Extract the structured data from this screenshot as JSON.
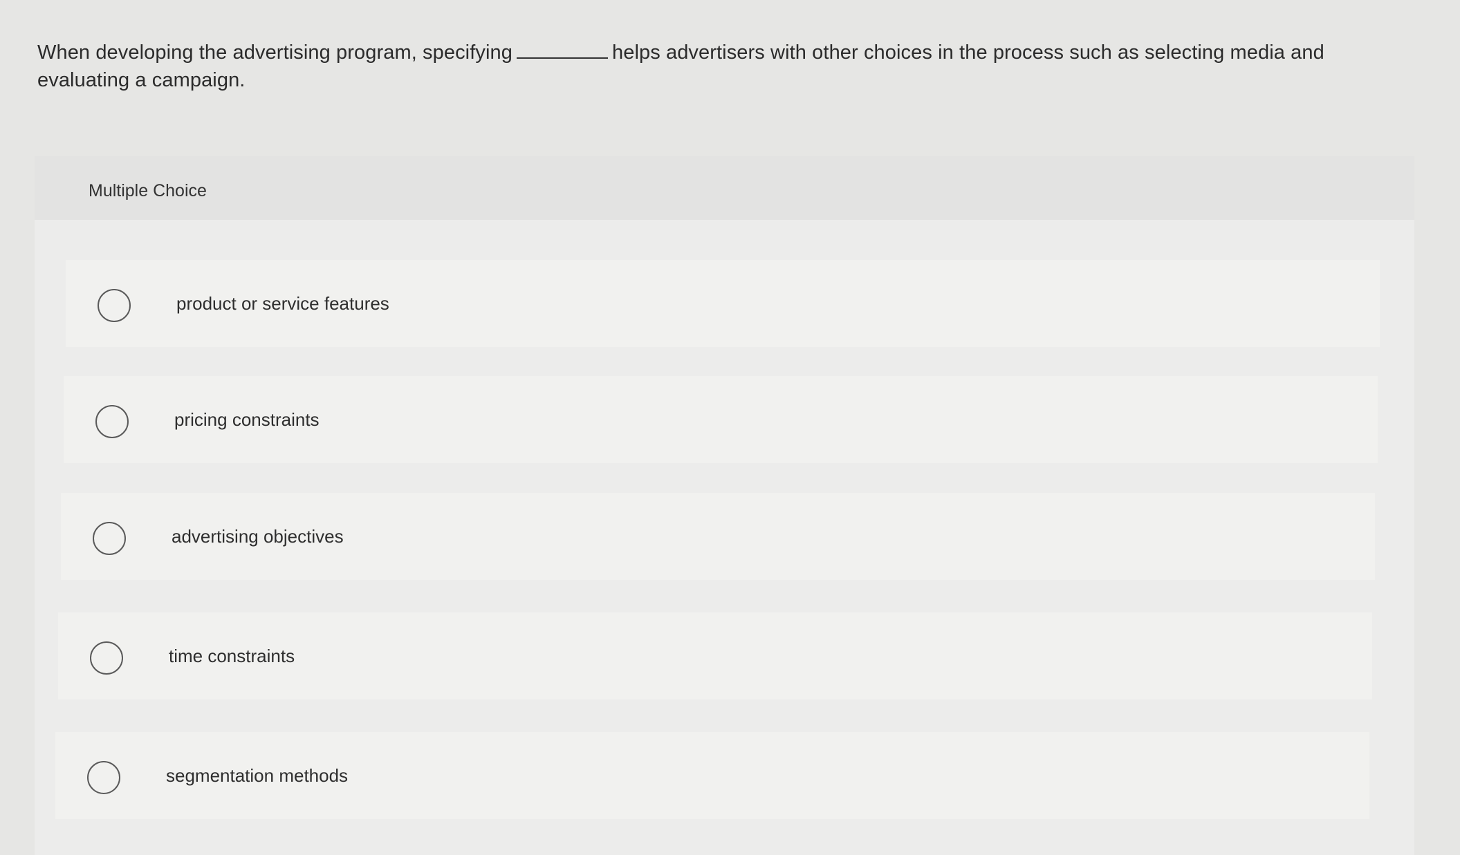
{
  "question": {
    "text_before": "When developing the advertising program, specifying",
    "text_after": "helps advertisers with other choices in the process such as selecting media and evaluating a campaign."
  },
  "panel": {
    "title": "Multiple Choice"
  },
  "options": [
    {
      "label": "product or service features"
    },
    {
      "label": "pricing constraints"
    },
    {
      "label": "advertising objectives"
    },
    {
      "label": "time constraints"
    },
    {
      "label": "segmentation methods"
    }
  ],
  "colors": {
    "page_background": "#e6e6e4",
    "panel_background": "#ececeb",
    "option_background": "#f1f1ef",
    "text": "#2b2b2b"
  }
}
